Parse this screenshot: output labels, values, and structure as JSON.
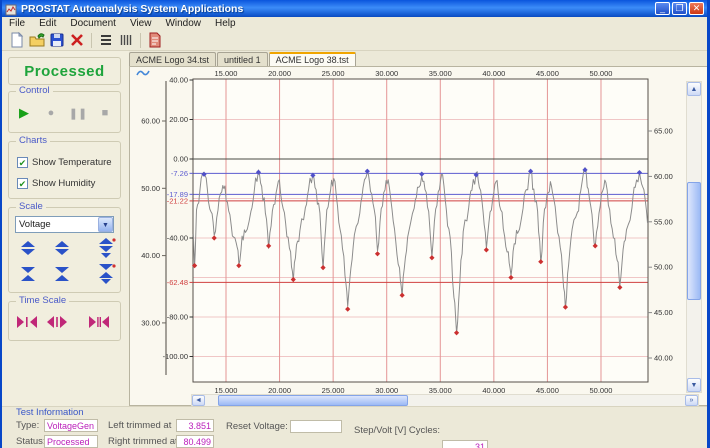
{
  "window": {
    "title": "PROSTAT Autoanalysis System Applications",
    "buttons": {
      "minimize": "_",
      "restore": "❐",
      "close": "✕"
    }
  },
  "menu": {
    "items": [
      "File",
      "Edit",
      "Document",
      "View",
      "Window",
      "Help"
    ]
  },
  "toolbar": {
    "icons": [
      "new-document",
      "open-folder",
      "save",
      "delete",
      "list-view",
      "column-view",
      "red-document"
    ]
  },
  "sidebar": {
    "status_label": "Processed",
    "control": {
      "label": "Control",
      "buttons": [
        "play",
        "record",
        "pause",
        "stop"
      ]
    },
    "charts": {
      "label": "Charts",
      "checkboxes": [
        {
          "label": "Show Temperature",
          "checked": true
        },
        {
          "label": "Show Humidity",
          "checked": true
        }
      ]
    },
    "scale": {
      "label": "Scale",
      "dropdown_value": "Voltage"
    },
    "time_scale": {
      "label": "Time Scale"
    }
  },
  "tabs": [
    {
      "label": "ACME Logo 34.tst",
      "active": false
    },
    {
      "label": "untitled 1",
      "active": false
    },
    {
      "label": "ACME Logo 38.tst",
      "active": true
    }
  ],
  "chart_data": {
    "type": "line",
    "x_axis": {
      "tick_values": [
        15,
        20,
        25,
        30,
        35,
        40,
        45,
        50
      ],
      "tick_labels": [
        "15.000",
        "20.000",
        "25.000",
        "30.000",
        "35.000",
        "40.000",
        "45.000",
        "50.000"
      ],
      "range": [
        11.9,
        54.5
      ],
      "position": "top-and-bottom",
      "gridline_color": "#e49595"
    },
    "inner_y_axis": {
      "range": [
        -115,
        41
      ],
      "ticks": [
        {
          "value": 40,
          "label": "40.00",
          "color": "#333333"
        },
        {
          "value": 20,
          "label": "20.00",
          "color": "#333333"
        },
        {
          "value": 0,
          "label": "0.00",
          "color": "#333333"
        },
        {
          "value": -7.26,
          "label": "-7.26",
          "color": "#5c5cd0"
        },
        {
          "value": -17.89,
          "label": "-17.89",
          "color": "#5c5cd0"
        },
        {
          "value": -21.22,
          "label": "-21.22",
          "color": "#d04040"
        },
        {
          "value": -40,
          "label": "-40.00",
          "color": "#333333"
        },
        {
          "value": -62.48,
          "label": "-62.48",
          "color": "#d04040"
        },
        {
          "value": -80,
          "label": "-80.00",
          "color": "#333333"
        },
        {
          "value": -100,
          "label": "-100.00",
          "color": "#333333"
        }
      ]
    },
    "right_y_axis": {
      "tick_values": [
        65,
        60,
        55,
        50,
        45,
        40
      ],
      "tick_labels": [
        "65.00",
        "60.00",
        "55.00",
        "50.00",
        "45.00",
        "40.00"
      ]
    },
    "outer_left_axis": {
      "tick_values": [
        60,
        50,
        40,
        30
      ],
      "tick_labels": [
        "60.00",
        "50.00",
        "40.00",
        "30.00"
      ]
    },
    "threshold_lines": [
      {
        "value": 0,
        "color": "#4a4a44"
      },
      {
        "value": -7.26,
        "color": "#5c5cd0"
      },
      {
        "value": -17.89,
        "color": "#5c5cd0"
      },
      {
        "value": -21.22,
        "color": "#d04040"
      },
      {
        "value": -62.48,
        "color": "#d04040"
      }
    ],
    "h_gridlines": [
      20,
      0,
      -20,
      -40,
      -60,
      -80,
      -100
    ],
    "h_gridline_color": "#f0c6c6",
    "series": [
      {
        "name": "voltage-waveform",
        "color": "#8c8c8c",
        "cycles": {
          "start": 12.0,
          "period": 5.08,
          "peak1": -7,
          "peak2": -11,
          "pre_trough": -54,
          "dips": [
            -40,
            -44,
            -55,
            -48,
            -50,
            -46,
            -52,
            -44,
            -47
          ],
          "troughs": [
            -54,
            -61,
            -76,
            -69,
            -88,
            -60,
            -75,
            -65,
            -72
          ]
        }
      }
    ],
    "markers": {
      "peak_color": "#5050c8",
      "trough_color": "#cc3030"
    }
  },
  "test_info": {
    "section_label": "Test Information",
    "type_label": "Type:",
    "type_value": "VoltageGen",
    "status_label": "Status:",
    "status_value": "Processed",
    "left_trimmed_label": "Left trimmed at",
    "left_trimmed_value": "3.851",
    "right_trimmed_label": "Right trimmed at",
    "right_trimmed_value": "80.499",
    "reset_voltage_label": "Reset Voltage:",
    "reset_voltage_value": "",
    "step_volt_label": "Step/Volt [V] Cycles:",
    "step_volt_value": "31"
  }
}
